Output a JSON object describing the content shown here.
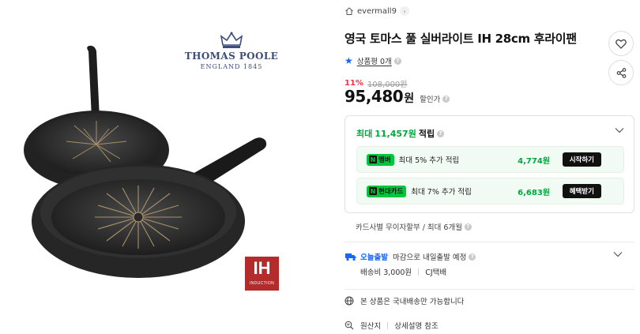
{
  "image": {
    "brand_name": "THOMAS POOLE",
    "brand_sub": "ENGLAND 1845",
    "ih_badge_big": "IH",
    "ih_badge_small": "INDUCTION"
  },
  "store": {
    "name": "evermall9"
  },
  "product": {
    "title": "영국 토마스 풀 실버라이트 IH 28cm 후라이팬",
    "rating_label": "상품평 0개",
    "discount_rate": "11%",
    "original_price": "108,000원",
    "price": "95,480",
    "price_unit": "원",
    "discount_label": "할인가"
  },
  "points": {
    "head_prefix": "최대",
    "head_amount": "11,457원",
    "head_suffix": "적립",
    "bonuses": [
      {
        "badge": "멤버",
        "desc": "최대 5% 추가 적립",
        "amount": "4,774원",
        "button": "시작하기"
      },
      {
        "badge": "현대카드",
        "desc": "최대 7% 추가 적립",
        "amount": "6,683원",
        "button": "혜택받기"
      }
    ]
  },
  "installment": "카드사별 무이자할부 / 최대 6개월",
  "shipping": {
    "today_label": "오늘출발",
    "today_desc": "마감으로 내일출발 예정",
    "fee": "배송비 3,000원",
    "courier": "CJ택배"
  },
  "domestic_notice": "본 상품은 국내배송만 가능합니다",
  "origin": {
    "label": "원산지",
    "value": "상세설명 참조"
  },
  "colors": {
    "accent_green": "#00c73c",
    "point_green": "#00a73c",
    "discount_red": "#f43142",
    "link_blue": "#1565ff"
  },
  "icons": [
    "home-icon",
    "heart-icon",
    "share-icon",
    "star-icon",
    "chevron-down-icon",
    "truck-icon",
    "globe-icon",
    "search-doc-icon"
  ]
}
